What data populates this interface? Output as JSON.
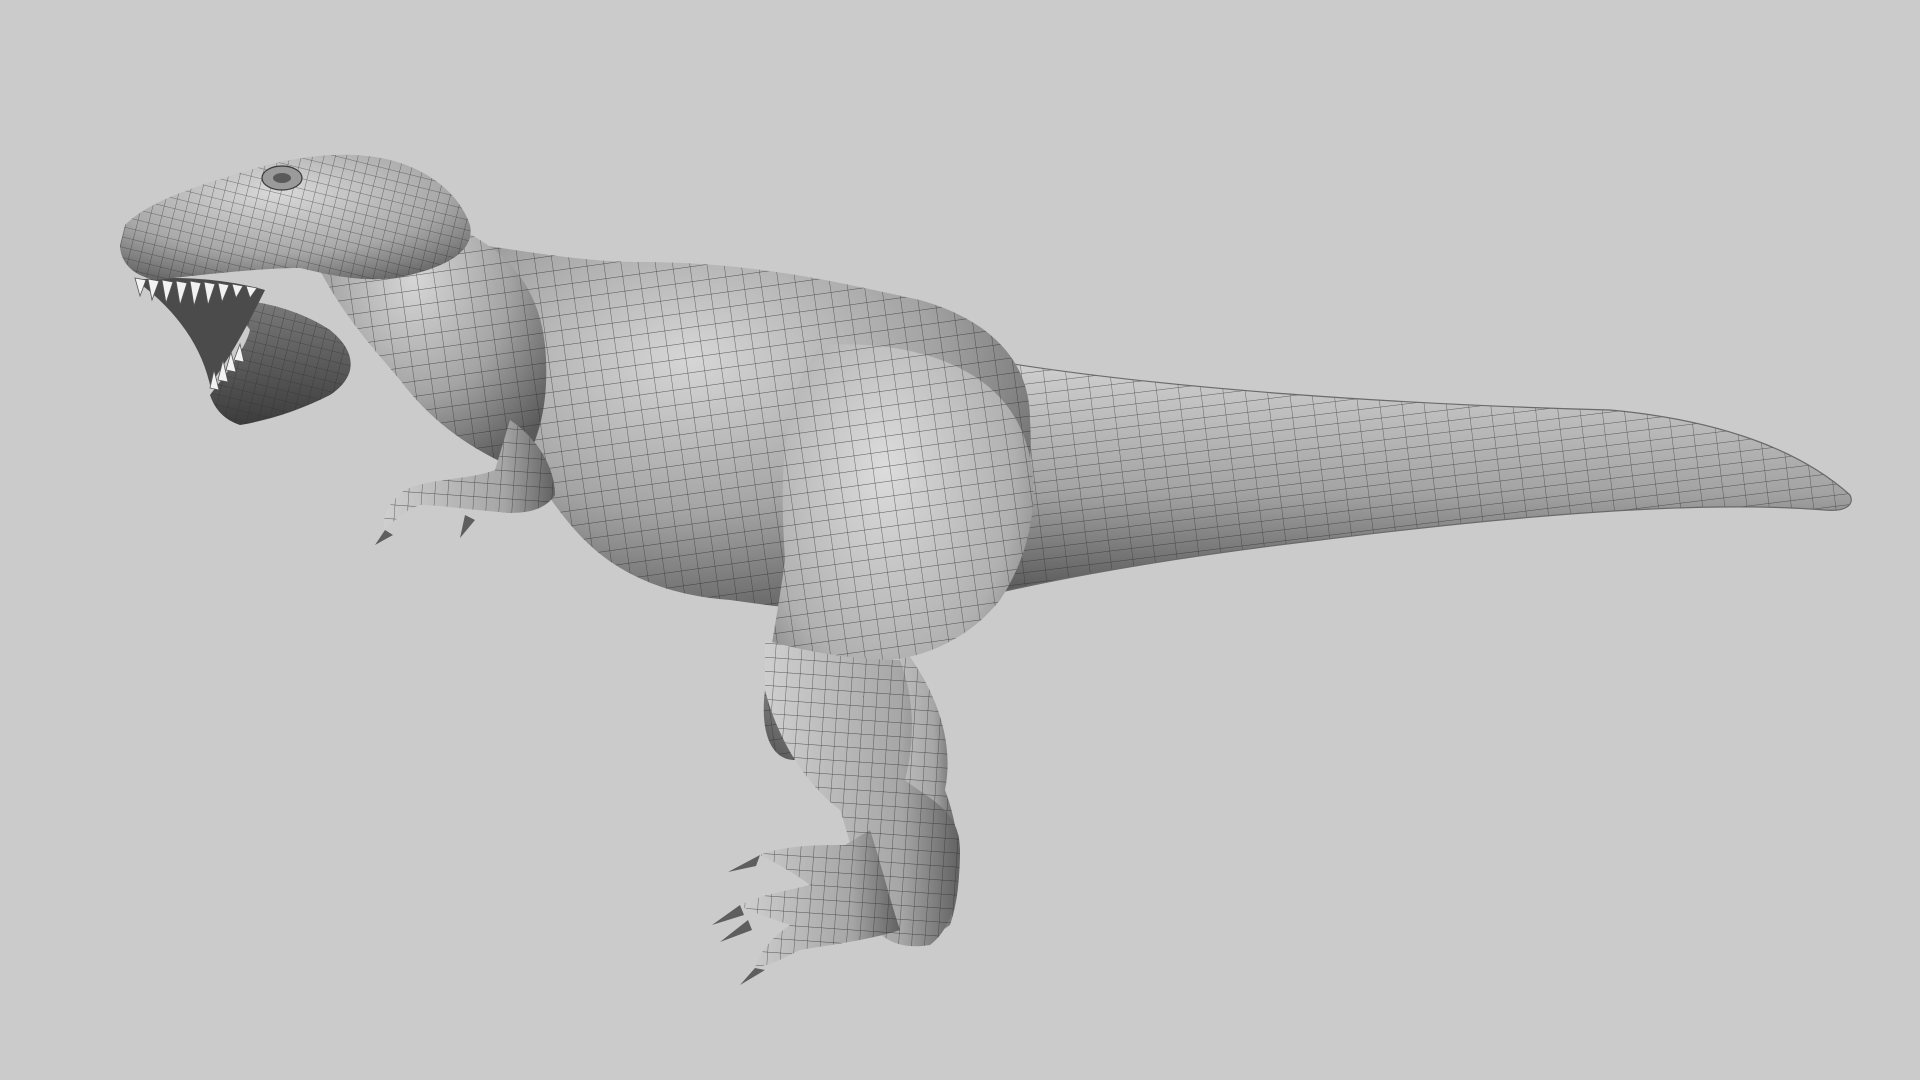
{
  "scene": {
    "subject": "t-rex-wireframe-render",
    "background_color": "#cbcbcb",
    "mesh_color": "#9a9a9a",
    "wire_color": "#333333",
    "shade_dark": "#4a4a4a",
    "shade_light": "#d4d4d4"
  }
}
